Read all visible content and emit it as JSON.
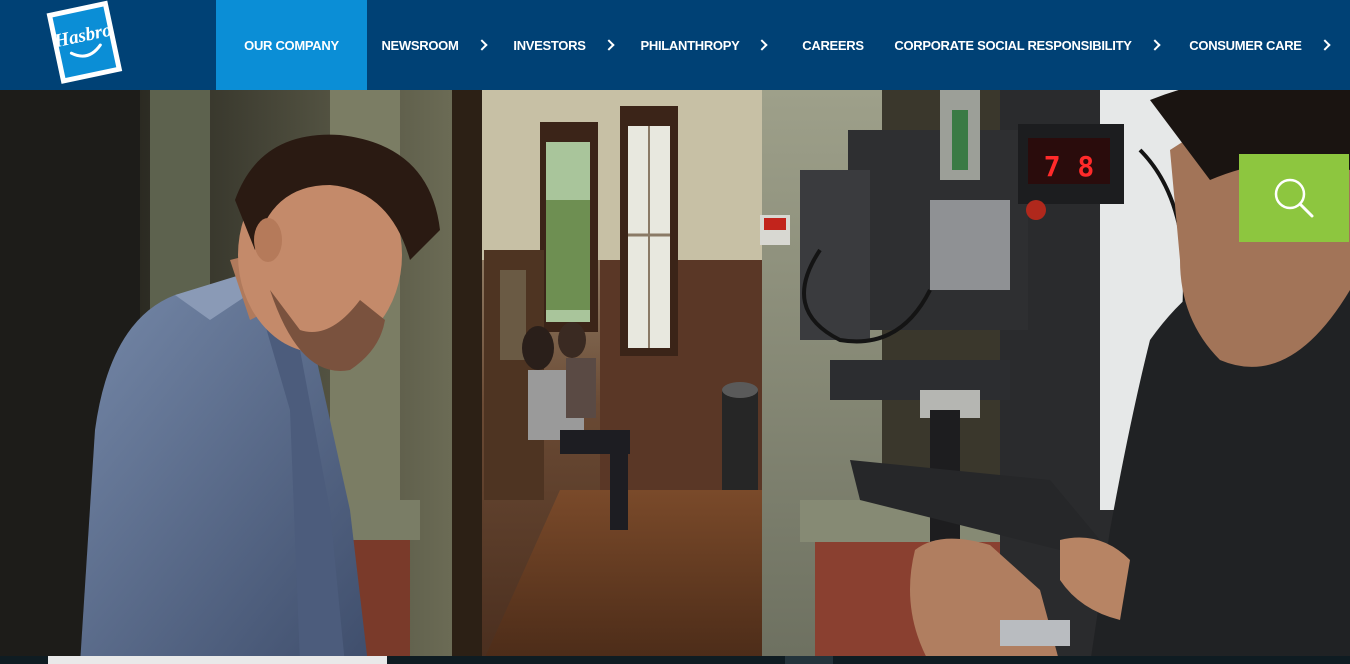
{
  "brand": {
    "logo_text": "Hasbro",
    "nav_bg": "#004175",
    "active_bg": "#0b8ed6",
    "search_bg": "#8dc63f"
  },
  "nav": {
    "items": [
      {
        "label": "OUR COMPANY",
        "active": true,
        "has_submenu": false
      },
      {
        "label": "NEWSROOM",
        "active": false,
        "has_submenu": true
      },
      {
        "label": "INVESTORS",
        "active": false,
        "has_submenu": true
      },
      {
        "label": "PHILANTHROPY",
        "active": false,
        "has_submenu": true
      },
      {
        "label": "CAREERS",
        "active": false,
        "has_submenu": false
      },
      {
        "label": "CORPORATE SOCIAL RESPONSIBILITY",
        "active": false,
        "has_submenu": true
      },
      {
        "label": "CONSUMER CARE",
        "active": false,
        "has_submenu": true
      }
    ]
  },
  "hero": {
    "camera_readout": "7 8",
    "search_icon": "search-icon"
  },
  "video": {
    "progress_fraction": 0.26,
    "timecode": ""
  }
}
